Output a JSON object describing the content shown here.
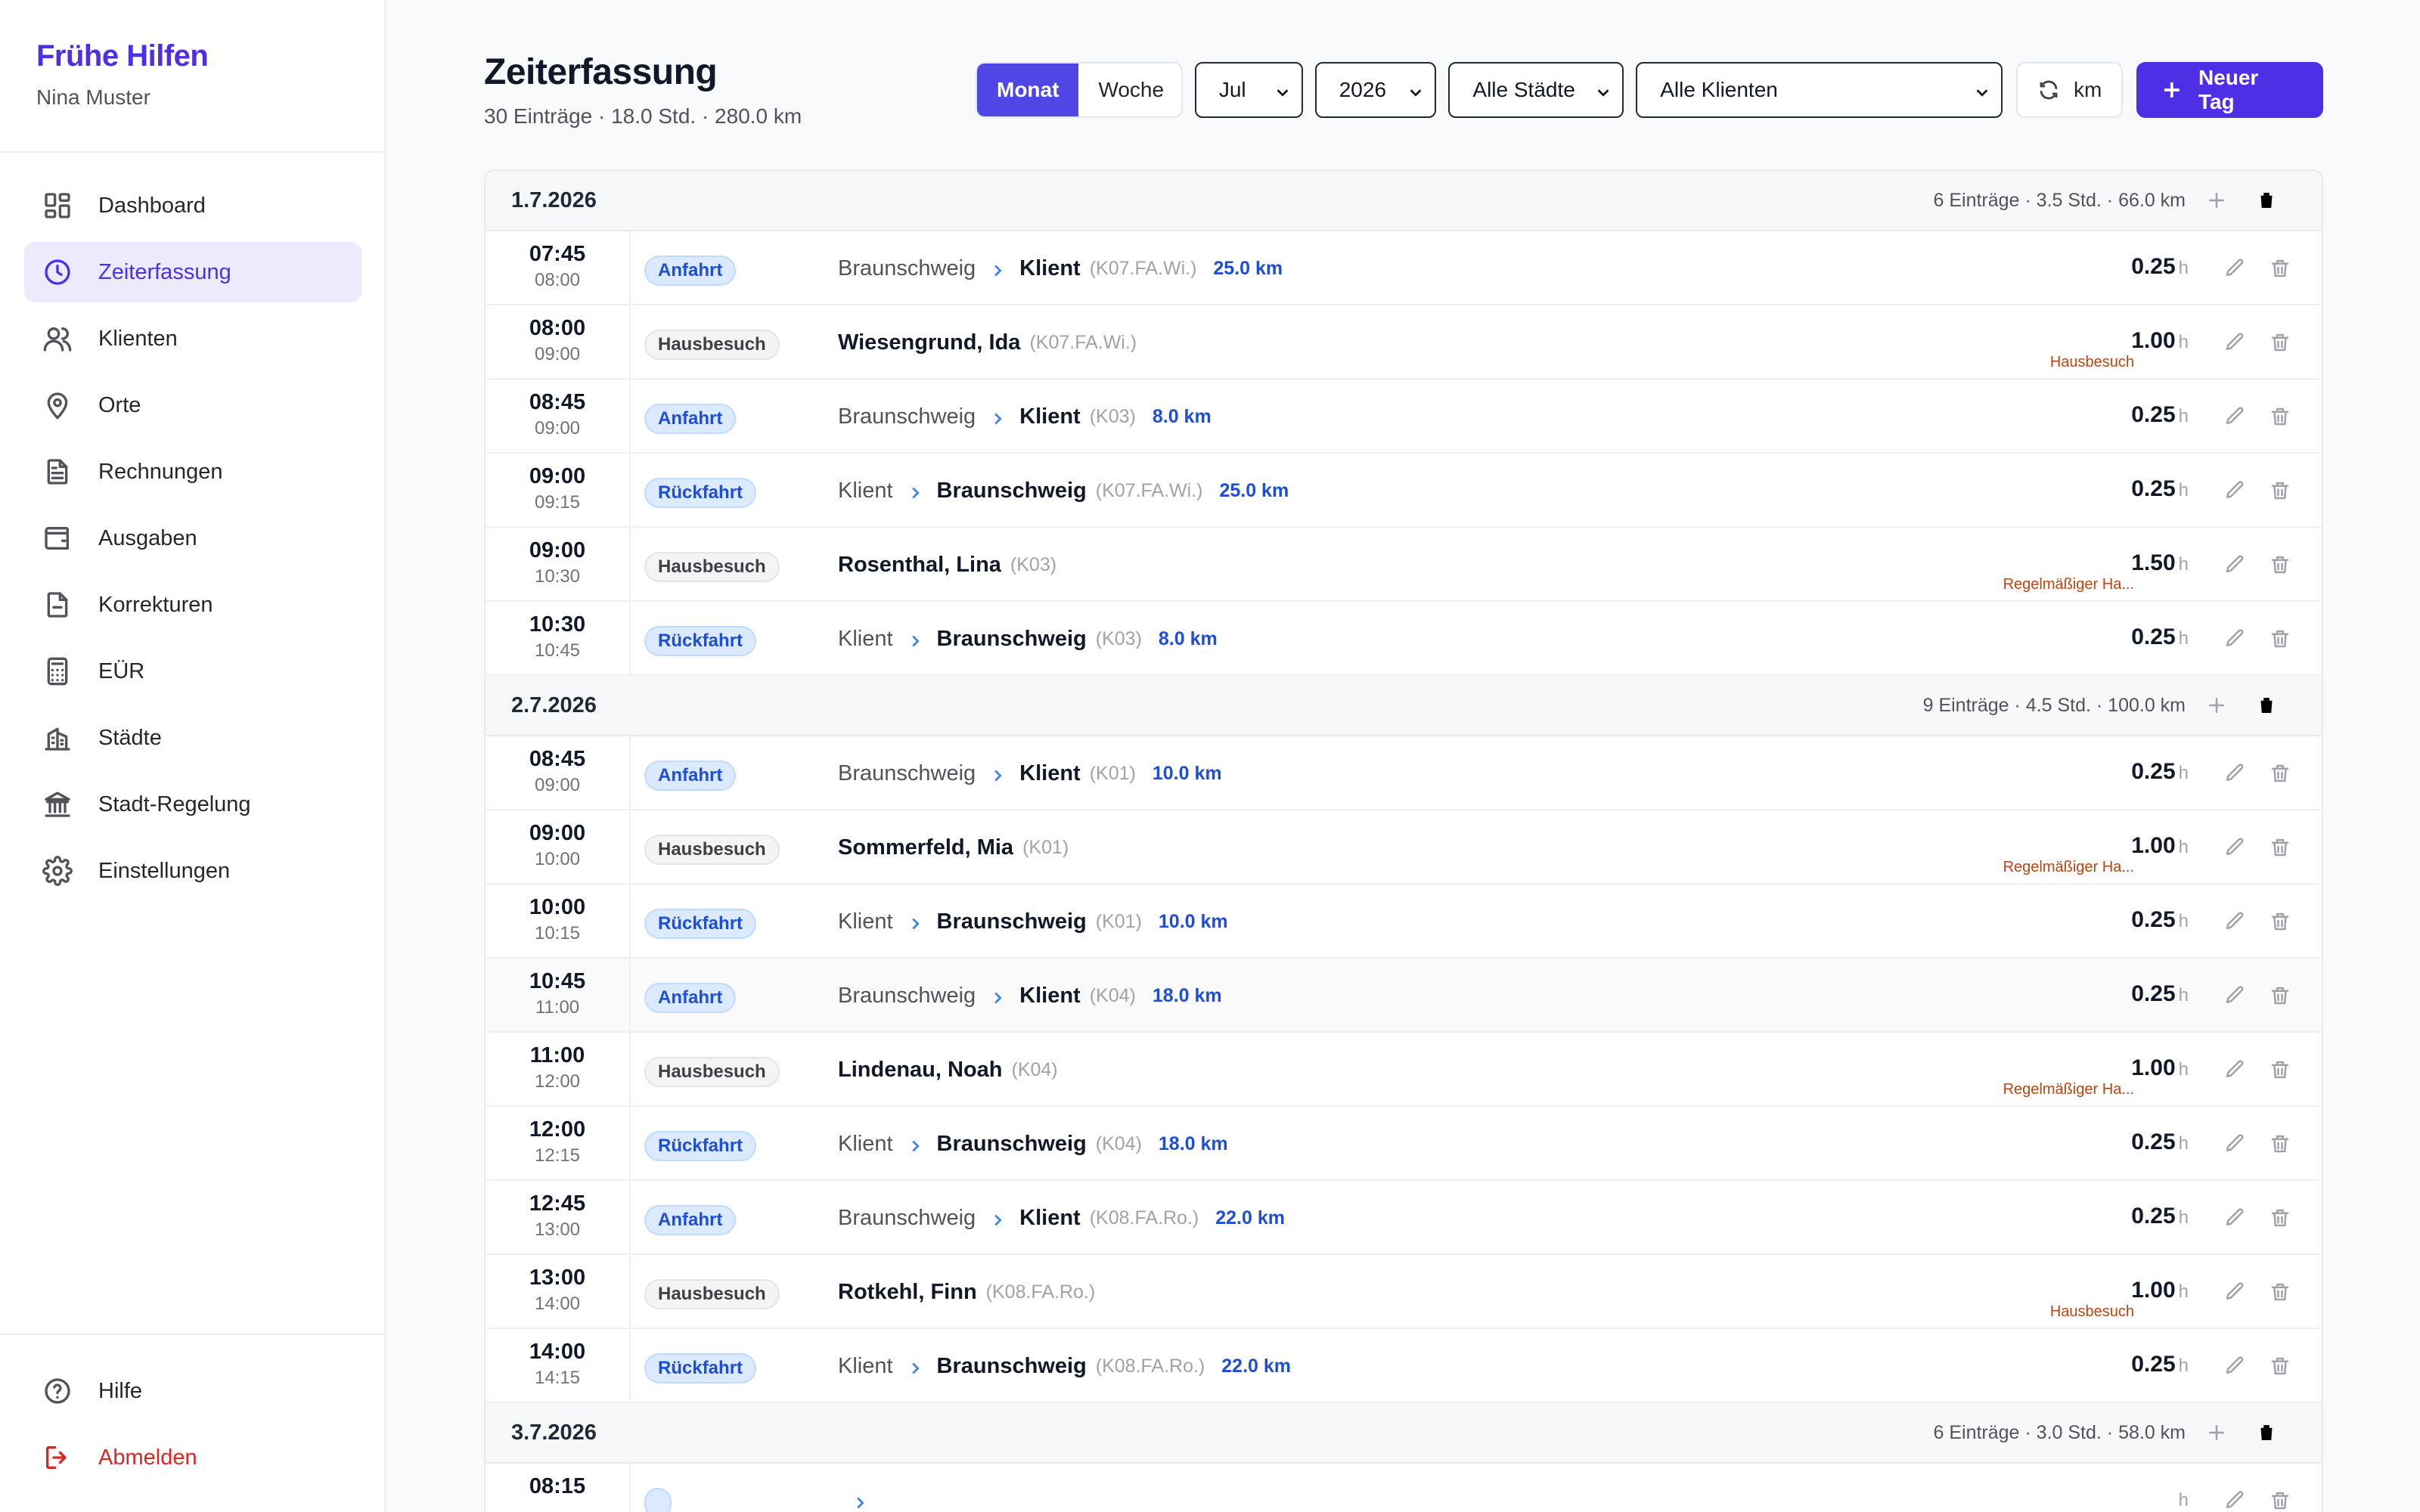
{
  "brand": {
    "name": "Frühe Hilfen",
    "user": "Nina Muster"
  },
  "nav": [
    {
      "label": "Dashboard",
      "icon": "dashboard-icon",
      "active": false
    },
    {
      "label": "Zeiterfassung",
      "icon": "clock-icon",
      "active": true
    },
    {
      "label": "Klienten",
      "icon": "users-icon",
      "active": false
    },
    {
      "label": "Orte",
      "icon": "map-pin-icon",
      "active": false
    },
    {
      "label": "Rechnungen",
      "icon": "document-icon",
      "active": false
    },
    {
      "label": "Ausgaben",
      "icon": "wallet-icon",
      "active": false
    },
    {
      "label": "Korrekturen",
      "icon": "file-minus-icon",
      "active": false
    },
    {
      "label": "EÜR",
      "icon": "calculator-icon",
      "active": false
    },
    {
      "label": "Städte",
      "icon": "building-icon",
      "active": false
    },
    {
      "label": "Stadt-Regelung",
      "icon": "bank-icon",
      "active": false
    },
    {
      "label": "Einstellungen",
      "icon": "gear-icon",
      "active": false
    }
  ],
  "nav_bottom": [
    {
      "label": "Hilfe",
      "icon": "help-icon"
    },
    {
      "label": "Abmelden",
      "icon": "logout-icon"
    }
  ],
  "page": {
    "title": "Zeiterfassung",
    "subtitle": "30 Einträge · 18.0 Std. · 280.0 km"
  },
  "toolbar": {
    "view_month": "Monat",
    "view_week": "Woche",
    "month": "Jul",
    "year": "2026",
    "city": "Alle Städte",
    "client": "Alle Klienten",
    "km_label": "km",
    "new_day_label": "Neuer Tag"
  },
  "colors": {
    "accent": "#4f2fe6",
    "drive_badge": "#dbeafe",
    "km_text": "#1d4ed8",
    "note_text": "#c2410c"
  },
  "days": [
    {
      "date": "1.7.2026",
      "summary": "6 Einträge · 3.5 Std. · 66.0 km",
      "entries": [
        {
          "start": "07:45",
          "end": "08:00",
          "type": "Anfahrt",
          "kind": "drive",
          "from": "Braunschweig",
          "to": "Klient",
          "bold": "to",
          "code": "(K07.FA.Wi.)",
          "km": "25.0 km",
          "hours": "0.25",
          "note": ""
        },
        {
          "start": "08:00",
          "end": "09:00",
          "type": "Hausbesuch",
          "kind": "visit",
          "name": "Wiesengrund, Ida",
          "code": "(K07.FA.Wi.)",
          "hours": "1.00",
          "note": "Hausbesuch"
        },
        {
          "start": "08:45",
          "end": "09:00",
          "type": "Anfahrt",
          "kind": "drive",
          "from": "Braunschweig",
          "to": "Klient",
          "bold": "to",
          "code": "(K03)",
          "km": "8.0 km",
          "hours": "0.25",
          "note": ""
        },
        {
          "start": "09:00",
          "end": "09:15",
          "type": "Rückfahrt",
          "kind": "drive",
          "from": "Klient",
          "to": "Braunschweig",
          "bold": "to",
          "code": "(K07.FA.Wi.)",
          "km": "25.0 km",
          "hours": "0.25",
          "note": ""
        },
        {
          "start": "09:00",
          "end": "10:30",
          "type": "Hausbesuch",
          "kind": "visit",
          "name": "Rosenthal, Lina",
          "code": "(K03)",
          "hours": "1.50",
          "note": "Regelmäßiger Ha..."
        },
        {
          "start": "10:30",
          "end": "10:45",
          "type": "Rückfahrt",
          "kind": "drive",
          "from": "Klient",
          "to": "Braunschweig",
          "bold": "to",
          "code": "(K03)",
          "km": "8.0 km",
          "hours": "0.25",
          "note": ""
        }
      ]
    },
    {
      "date": "2.7.2026",
      "summary": "9 Einträge · 4.5 Std. · 100.0 km",
      "entries": [
        {
          "start": "08:45",
          "end": "09:00",
          "type": "Anfahrt",
          "kind": "drive",
          "from": "Braunschweig",
          "to": "Klient",
          "bold": "to",
          "code": "(K01)",
          "km": "10.0 km",
          "hours": "0.25",
          "note": ""
        },
        {
          "start": "09:00",
          "end": "10:00",
          "type": "Hausbesuch",
          "kind": "visit",
          "name": "Sommerfeld, Mia",
          "code": "(K01)",
          "hours": "1.00",
          "note": "Regelmäßiger Ha..."
        },
        {
          "start": "10:00",
          "end": "10:15",
          "type": "Rückfahrt",
          "kind": "drive",
          "from": "Klient",
          "to": "Braunschweig",
          "bold": "to",
          "code": "(K01)",
          "km": "10.0 km",
          "hours": "0.25",
          "note": ""
        },
        {
          "start": "10:45",
          "end": "11:00",
          "type": "Anfahrt",
          "kind": "drive",
          "from": "Braunschweig",
          "to": "Klient",
          "bold": "to",
          "code": "(K04)",
          "km": "18.0 km",
          "hours": "0.25",
          "note": "",
          "highlight": true
        },
        {
          "start": "11:00",
          "end": "12:00",
          "type": "Hausbesuch",
          "kind": "visit",
          "name": "Lindenau, Noah",
          "code": "(K04)",
          "hours": "1.00",
          "note": "Regelmäßiger Ha..."
        },
        {
          "start": "12:00",
          "end": "12:15",
          "type": "Rückfahrt",
          "kind": "drive",
          "from": "Klient",
          "to": "Braunschweig",
          "bold": "to",
          "code": "(K04)",
          "km": "18.0 km",
          "hours": "0.25",
          "note": ""
        },
        {
          "start": "12:45",
          "end": "13:00",
          "type": "Anfahrt",
          "kind": "drive",
          "from": "Braunschweig",
          "to": "Klient",
          "bold": "to",
          "code": "(K08.FA.Ro.)",
          "km": "22.0 km",
          "hours": "0.25",
          "note": ""
        },
        {
          "start": "13:00",
          "end": "14:00",
          "type": "Hausbesuch",
          "kind": "visit",
          "name": "Rotkehl, Finn",
          "code": "(K08.FA.Ro.)",
          "hours": "1.00",
          "note": "Hausbesuch"
        },
        {
          "start": "14:00",
          "end": "14:15",
          "type": "Rückfahrt",
          "kind": "drive",
          "from": "Klient",
          "to": "Braunschweig",
          "bold": "to",
          "code": "(K08.FA.Ro.)",
          "km": "22.0 km",
          "hours": "0.25",
          "note": ""
        }
      ]
    },
    {
      "date": "3.7.2026",
      "summary": "6 Einträge · 3.0 Std. · 58.0 km",
      "entries": [
        {
          "start": "08:15",
          "end": "",
          "type": "",
          "kind": "drive",
          "from": "",
          "to": "",
          "bold": "to",
          "code": "",
          "km": "",
          "hours": "",
          "note": ""
        }
      ]
    }
  ],
  "hours_unit": "h"
}
